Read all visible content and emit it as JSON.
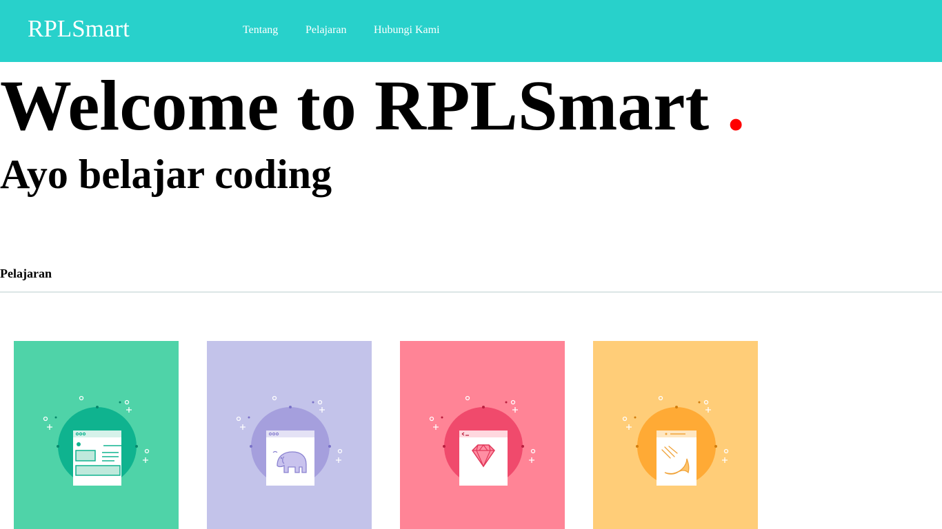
{
  "navbar": {
    "brand": "RPLSmart",
    "links": [
      {
        "label": "Tentang"
      },
      {
        "label": "Pelajaran"
      },
      {
        "label": "Hubungi Kami"
      }
    ],
    "background": "#28d1cb"
  },
  "hero": {
    "title": "Welcome to RPLSmart",
    "dot": ".",
    "dot_color": "#ff0000",
    "subtitle": "Ayo belajar coding"
  },
  "courses": {
    "heading": "Pelajaran",
    "cards": [
      {
        "icon": "html-css-icon",
        "bg_color": "#4fd3a8",
        "circle_color": "#0fb38f"
      },
      {
        "icon": "php-elephant-icon",
        "bg_color": "#c3c3ea",
        "circle_color": "#a59fdd"
      },
      {
        "icon": "ruby-gem-icon",
        "bg_color": "#ff8496",
        "circle_color": "#f04a6c"
      },
      {
        "icon": "swift-bird-icon",
        "bg_color": "#ffcd78",
        "circle_color": "#ffaa35"
      }
    ]
  }
}
